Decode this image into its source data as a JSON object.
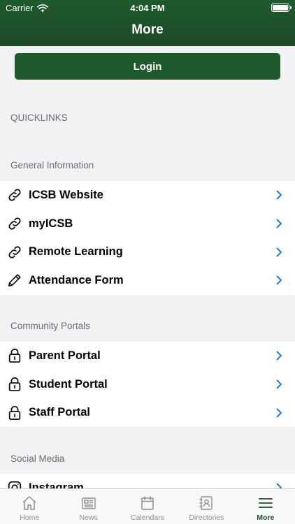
{
  "status": {
    "carrier": "Carrier",
    "time": "4:04 PM"
  },
  "header": {
    "title": "More"
  },
  "login": {
    "label": "Login"
  },
  "quicklinks": {
    "label": "QUICKLINKS"
  },
  "general": {
    "label": "General Information",
    "items": [
      {
        "label": "ICSB Website",
        "icon": "link-icon"
      },
      {
        "label": "myICSB",
        "icon": "link-icon"
      },
      {
        "label": "Remote Learning",
        "icon": "link-icon"
      },
      {
        "label": "Attendance Form",
        "icon": "pencil-icon"
      }
    ]
  },
  "portals": {
    "label": "Community Portals",
    "items": [
      {
        "label": "Parent Portal",
        "icon": "lock-icon"
      },
      {
        "label": "Student Portal",
        "icon": "lock-icon"
      },
      {
        "label": "Staff Portal",
        "icon": "lock-icon"
      }
    ]
  },
  "social": {
    "label": "Social Media",
    "items": [
      {
        "label": "Instagram",
        "icon": "instagram-icon"
      }
    ]
  },
  "tabs": [
    {
      "label": "Home",
      "icon": "home-icon",
      "active": false
    },
    {
      "label": "News",
      "icon": "newspaper-icon",
      "active": false
    },
    {
      "label": "Calendars",
      "icon": "calendar-icon",
      "active": false
    },
    {
      "label": "Directories",
      "icon": "contacts-icon",
      "active": false
    },
    {
      "label": "More",
      "icon": "menu-icon",
      "active": true
    }
  ],
  "colors": {
    "brand": "#1f5a2c",
    "chevron": "#2a7bc0",
    "active_tab": "#1f4f2a",
    "inactive_tab": "#8e8e93"
  }
}
